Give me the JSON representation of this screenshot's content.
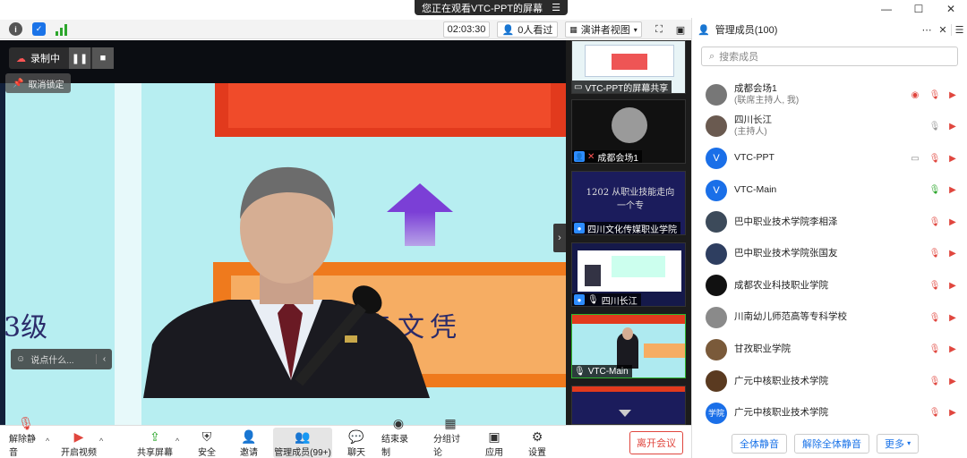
{
  "window": {
    "title": "您正在观看VTC-PPT的屏幕",
    "controls": [
      "minimize-icon",
      "maximize-icon",
      "close-icon"
    ]
  },
  "infobar": {
    "timer": "02:03:30",
    "viewers": "0人看过",
    "view_mode": "演讲者视图"
  },
  "recording": {
    "label": "录制中",
    "unlock_label": "取消锁定"
  },
  "chat": {
    "placeholder": "说点什么..."
  },
  "slide": {
    "text_left": "3级",
    "text_main": "职专文凭"
  },
  "thumbnails": [
    {
      "caption": "VTC-PPT的屏幕共享",
      "kind": "screen"
    },
    {
      "caption": "成都会场1",
      "kind": "avatar"
    },
    {
      "caption": "四川文化传媒职业学院",
      "kind": "video",
      "overlay": "1202 从职业技能走向 一个专"
    },
    {
      "caption": "四川长江",
      "kind": "video"
    },
    {
      "caption": "VTC-Main",
      "kind": "video"
    },
    {
      "caption": "",
      "kind": "video"
    }
  ],
  "panel": {
    "title": "管理成员(100)",
    "search_placeholder": "搜索成员",
    "members": [
      {
        "name": "成都会场1",
        "role": "(联席主持人, 我)",
        "avatar": "photo",
        "color": "#777"
      },
      {
        "name": "四川长江",
        "role": "(主持人)",
        "avatar": "photo",
        "color": "#6a5a50"
      },
      {
        "name": "VTC-PPT",
        "role": "",
        "avatar": "V",
        "color": "#1a6fe8"
      },
      {
        "name": "VTC-Main",
        "role": "",
        "avatar": "V",
        "color": "#1a6fe8"
      },
      {
        "name": "巴中职业技术学院李相泽",
        "role": "",
        "avatar": "photo",
        "color": "#3c4a5a"
      },
      {
        "name": "巴中职业技术学院张国友",
        "role": "",
        "avatar": "photo",
        "color": "#2e3e60"
      },
      {
        "name": "成都农业科技职业学院",
        "role": "",
        "avatar": "photo",
        "color": "#111"
      },
      {
        "name": "川南幼儿师范高等专科学校",
        "role": "",
        "avatar": "photo",
        "color": "#8a8a8a"
      },
      {
        "name": "甘孜职业学院",
        "role": "",
        "avatar": "photo",
        "color": "#7a5a3a"
      },
      {
        "name": "广元中核职业技术学院",
        "role": "",
        "avatar": "photo",
        "color": "#5a3a20"
      },
      {
        "name": "广元中核职业技术学院",
        "role": "",
        "avatar": "学院",
        "color": "#1a6fe8"
      }
    ],
    "footer": {
      "mute_all": "全体静音",
      "unmute_all": "解除全体静音",
      "more": "更多"
    }
  },
  "toolbar": {
    "unmute": "解除静音",
    "video": "开启视频",
    "share": "共享屏幕",
    "security": "安全",
    "invite": "邀请",
    "members": "管理成员(99+)",
    "chat": "聊天",
    "stop_record": "结束录制",
    "breakout": "分组讨论",
    "apps": "应用",
    "settings": "设置",
    "leave": "离开会议"
  }
}
